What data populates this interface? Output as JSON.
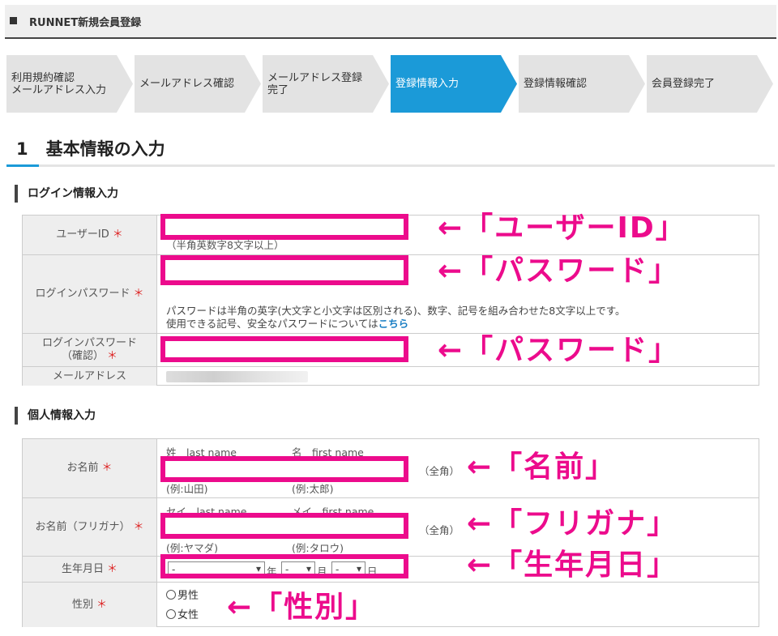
{
  "header": {
    "title": "RUNNET新規会員登録"
  },
  "steps": [
    {
      "line1": "利用規約確認",
      "line2": "メールアドレス入力"
    },
    {
      "line1": "メールアドレス確認",
      "line2": ""
    },
    {
      "line1": "メールアドレス登録",
      "line2": "完了"
    },
    {
      "line1": "登録情報入力",
      "line2": ""
    },
    {
      "line1": "登録情報確認",
      "line2": ""
    },
    {
      "line1": "会員登録完了",
      "line2": ""
    }
  ],
  "active_step": 3,
  "section": {
    "number": "1",
    "title": "基本情報の入力"
  },
  "login": {
    "heading": "ログイン情報入力",
    "userid_label": "ユーザーID",
    "userid_hint": "（半角英数字8文字以上）",
    "password_label": "ログインパスワード",
    "password_note_line1": "パスワードは半角の英字(大文字と小文字は区別される)、数字、記号を組み合わせた8文字以上です。",
    "password_note_line2": "使用できる記号、安全なパスワードについては",
    "password_note_link": "こちら",
    "password_confirm_label_1": "ログインパスワード",
    "password_confirm_label_2": "（確認）",
    "email_label": "メールアドレス"
  },
  "personal": {
    "heading": "個人情報入力",
    "name_label": "お名前",
    "last_name_header": "姓　last name",
    "first_name_header": "名　first name",
    "last_name_example": "(例:山田)",
    "first_name_example": "(例:太郎)",
    "fullwidth": "（全角）",
    "kana_label": "お名前（フリガナ）",
    "kana_last_header": "セイ　last name",
    "kana_first_header": "メイ　first name",
    "kana_last_example": "(例:ヤマダ)",
    "kana_first_example": "(例:タロウ)",
    "birth_label": "生年月日",
    "birth_year_value": "-",
    "birth_year_unit": "年",
    "birth_month_value": "-",
    "birth_month_unit": "月",
    "birth_day_value": "-",
    "birth_day_unit": "日",
    "gender_label": "性別",
    "gender_male": "男性",
    "gender_female": "女性"
  },
  "required_mark": "＊",
  "annotations": {
    "userid": "←「ユーザーID」",
    "password": "←「パスワード」",
    "password_confirm": "←「パスワード」",
    "name": "←「名前」",
    "kana": "←「フリガナ」",
    "birth": "←「生年月日」",
    "gender": "←「性別」"
  },
  "colors": {
    "accent": "#1b9ad8",
    "annotation": "#ec0b8c",
    "required": "#dd2222"
  }
}
